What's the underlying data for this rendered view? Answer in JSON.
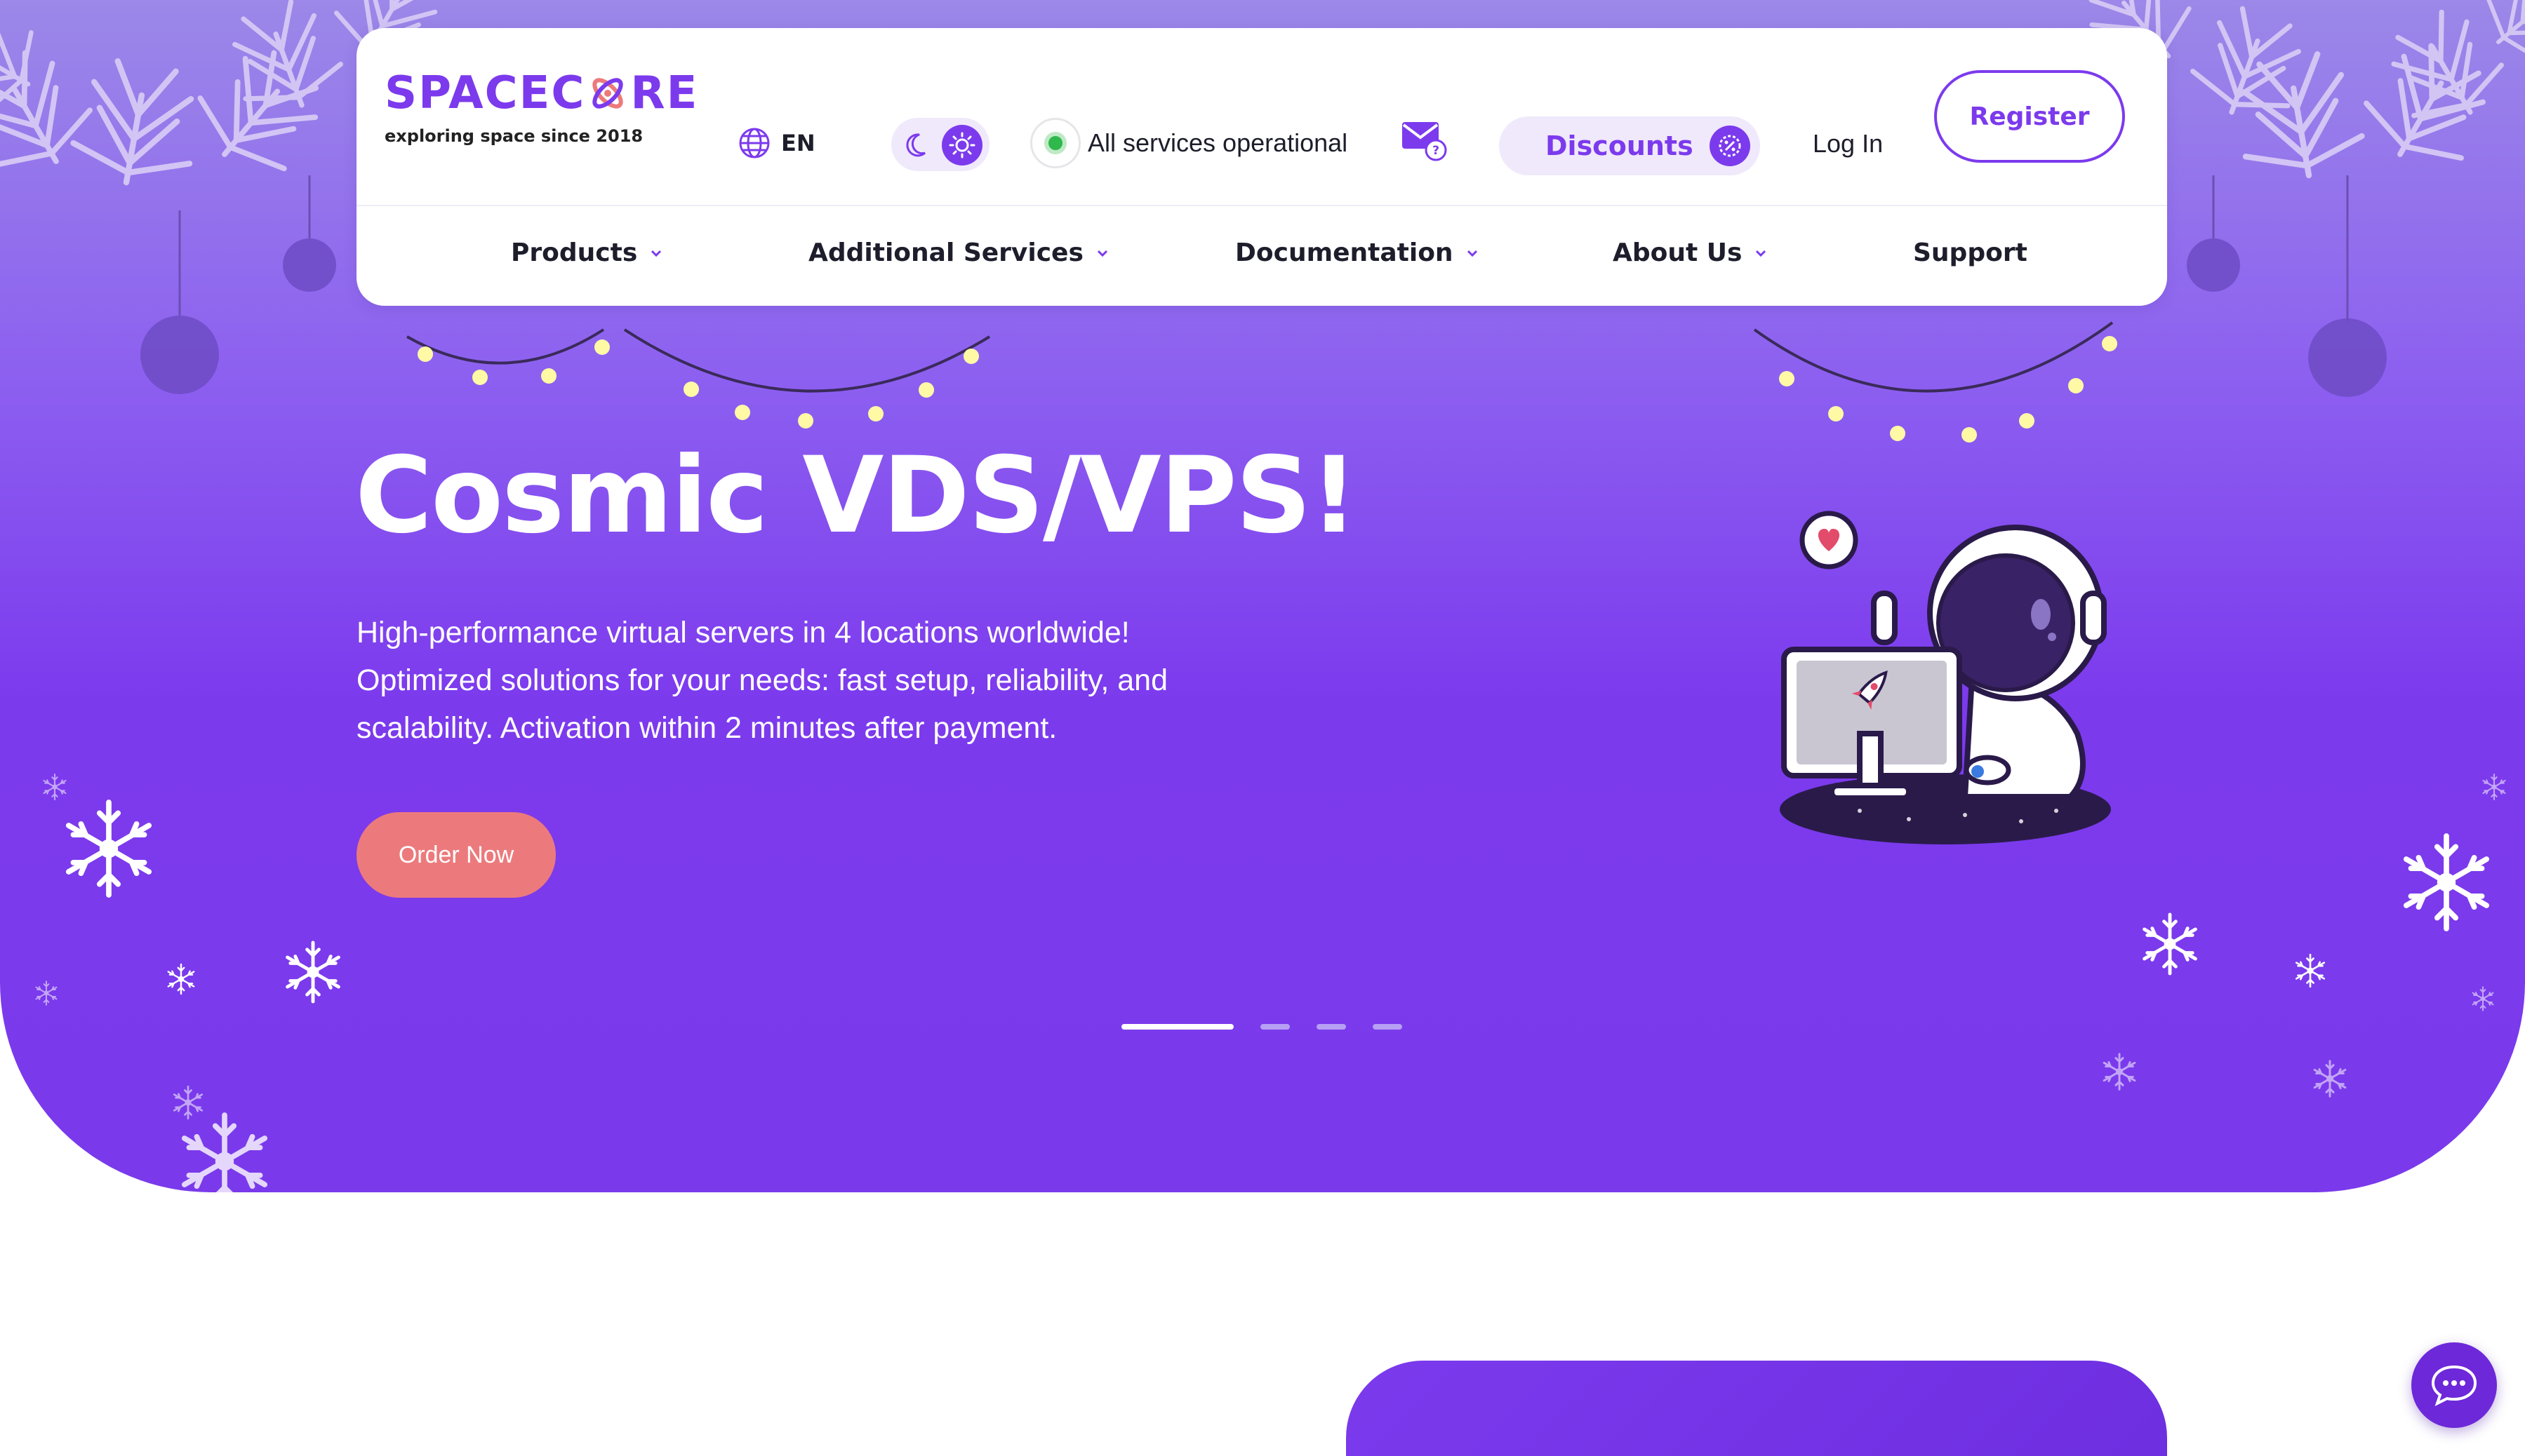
{
  "brand": {
    "name_part1": "SPACEC",
    "name_part2": "RE",
    "tagline": "exploring space since 2018"
  },
  "header": {
    "language": "EN",
    "theme_toggle": {
      "selected": "light"
    },
    "status": {
      "label": "All services operational",
      "color": "#2fb84b"
    },
    "discounts_label": "Discounts",
    "login_label": "Log In",
    "register_label": "Register"
  },
  "nav": {
    "items": [
      {
        "label": "Products",
        "has_dropdown": true
      },
      {
        "label": "Additional Services",
        "has_dropdown": true
      },
      {
        "label": "Documentation",
        "has_dropdown": true
      },
      {
        "label": "About Us",
        "has_dropdown": true
      },
      {
        "label": "Support",
        "has_dropdown": false
      }
    ]
  },
  "hero": {
    "title": "Cosmic VDS/VPS!",
    "description": "High-performance virtual servers in 4 locations worldwide! Optimized solutions for your needs: fast setup, reliability, and scalability. Activation within 2 minutes after payment.",
    "cta_label": "Order Now",
    "slides_total": 4,
    "active_slide": 1
  },
  "colors": {
    "accent": "#7c3aed",
    "cta": "#ec7a7c",
    "hero_top": "#9b88e8",
    "hero_bottom": "#7a3aeb"
  },
  "icons": [
    "globe-icon",
    "moon-icon",
    "sun-icon",
    "status-dot-icon",
    "mail-question-icon",
    "percent-badge-icon",
    "chevron-down-icon",
    "chat-bubble-icon",
    "astronaut-illustration",
    "snowflake-icon",
    "pine-branch-decoration",
    "string-lights-decoration"
  ]
}
